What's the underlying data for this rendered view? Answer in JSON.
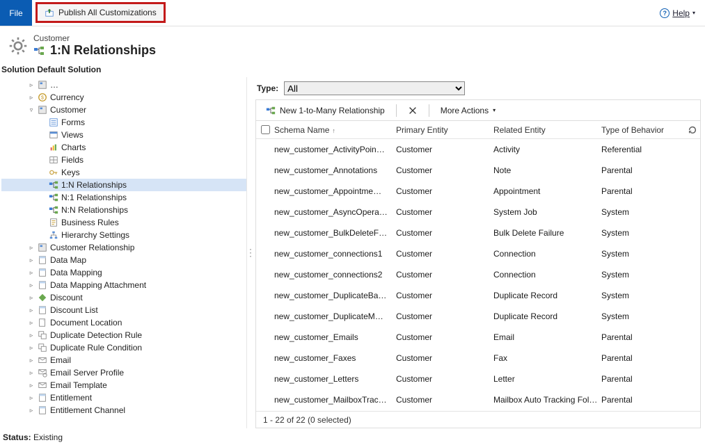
{
  "topbar": {
    "file_label": "File",
    "publish_label": "Publish All Customizations",
    "help_label": "Help"
  },
  "header": {
    "entity": "Customer",
    "title": "1:N Relationships"
  },
  "left": {
    "solution_label": "Solution Default Solution"
  },
  "tree": [
    {
      "depth": 2,
      "tw": "r",
      "icon": "block",
      "label": "…"
    },
    {
      "depth": 2,
      "tw": "r",
      "icon": "currency",
      "label": "Currency"
    },
    {
      "depth": 2,
      "tw": "d",
      "icon": "entity",
      "label": "Customer"
    },
    {
      "depth": 3,
      "tw": "n",
      "icon": "form",
      "label": "Forms"
    },
    {
      "depth": 3,
      "tw": "n",
      "icon": "view",
      "label": "Views"
    },
    {
      "depth": 3,
      "tw": "n",
      "icon": "chart",
      "label": "Charts"
    },
    {
      "depth": 3,
      "tw": "n",
      "icon": "field",
      "label": "Fields"
    },
    {
      "depth": 3,
      "tw": "n",
      "icon": "key",
      "label": "Keys"
    },
    {
      "depth": 3,
      "tw": "n",
      "icon": "rel1n",
      "label": "1:N Relationships",
      "selected": true
    },
    {
      "depth": 3,
      "tw": "n",
      "icon": "reln1",
      "label": "N:1 Relationships"
    },
    {
      "depth": 3,
      "tw": "n",
      "icon": "relnn",
      "label": "N:N Relationships"
    },
    {
      "depth": 3,
      "tw": "n",
      "icon": "rule",
      "label": "Business Rules"
    },
    {
      "depth": 3,
      "tw": "n",
      "icon": "hier",
      "label": "Hierarchy Settings"
    },
    {
      "depth": 2,
      "tw": "r",
      "icon": "entity",
      "label": "Customer Relationship"
    },
    {
      "depth": 2,
      "tw": "r",
      "icon": "data",
      "label": "Data Map"
    },
    {
      "depth": 2,
      "tw": "r",
      "icon": "data",
      "label": "Data Mapping"
    },
    {
      "depth": 2,
      "tw": "r",
      "icon": "data",
      "label": "Data Mapping Attachment"
    },
    {
      "depth": 2,
      "tw": "r",
      "icon": "discount",
      "label": "Discount"
    },
    {
      "depth": 2,
      "tw": "r",
      "icon": "data",
      "label": "Discount List"
    },
    {
      "depth": 2,
      "tw": "r",
      "icon": "doc",
      "label": "Document Location"
    },
    {
      "depth": 2,
      "tw": "r",
      "icon": "dup",
      "label": "Duplicate Detection Rule"
    },
    {
      "depth": 2,
      "tw": "r",
      "icon": "dup",
      "label": "Duplicate Rule Condition"
    },
    {
      "depth": 2,
      "tw": "r",
      "icon": "mail",
      "label": "Email"
    },
    {
      "depth": 2,
      "tw": "r",
      "icon": "mailsrv",
      "label": "Email Server Profile"
    },
    {
      "depth": 2,
      "tw": "r",
      "icon": "mail",
      "label": "Email Template"
    },
    {
      "depth": 2,
      "tw": "r",
      "icon": "data",
      "label": "Entitlement"
    },
    {
      "depth": 2,
      "tw": "r",
      "icon": "data",
      "label": "Entitlement Channel"
    }
  ],
  "right": {
    "type_label": "Type:",
    "type_value": "All",
    "new_rel_label": "New 1-to-Many Relationship",
    "more_actions_label": "More Actions",
    "columns": {
      "schema": "Schema Name",
      "primary": "Primary Entity",
      "related": "Related Entity",
      "behavior": "Type of Behavior"
    },
    "rows": [
      {
        "schema": "new_customer_ActivityPoin…",
        "primary": "Customer",
        "related": "Activity",
        "behavior": "Referential"
      },
      {
        "schema": "new_customer_Annotations",
        "primary": "Customer",
        "related": "Note",
        "behavior": "Parental"
      },
      {
        "schema": "new_customer_Appointme…",
        "primary": "Customer",
        "related": "Appointment",
        "behavior": "Parental"
      },
      {
        "schema": "new_customer_AsyncOpera…",
        "primary": "Customer",
        "related": "System Job",
        "behavior": "System"
      },
      {
        "schema": "new_customer_BulkDeleteF…",
        "primary": "Customer",
        "related": "Bulk Delete Failure",
        "behavior": "System"
      },
      {
        "schema": "new_customer_connections1",
        "primary": "Customer",
        "related": "Connection",
        "behavior": "System"
      },
      {
        "schema": "new_customer_connections2",
        "primary": "Customer",
        "related": "Connection",
        "behavior": "System"
      },
      {
        "schema": "new_customer_DuplicateBa…",
        "primary": "Customer",
        "related": "Duplicate Record",
        "behavior": "System"
      },
      {
        "schema": "new_customer_DuplicateM…",
        "primary": "Customer",
        "related": "Duplicate Record",
        "behavior": "System"
      },
      {
        "schema": "new_customer_Emails",
        "primary": "Customer",
        "related": "Email",
        "behavior": "Parental"
      },
      {
        "schema": "new_customer_Faxes",
        "primary": "Customer",
        "related": "Fax",
        "behavior": "Parental"
      },
      {
        "schema": "new_customer_Letters",
        "primary": "Customer",
        "related": "Letter",
        "behavior": "Parental"
      },
      {
        "schema": "new_customer_MailboxTrac…",
        "primary": "Customer",
        "related": "Mailbox Auto Tracking Fold…",
        "behavior": "Parental"
      }
    ],
    "footer": "1 - 22 of 22 (0 selected)"
  },
  "status": {
    "label": "Status:",
    "value": "Existing"
  }
}
